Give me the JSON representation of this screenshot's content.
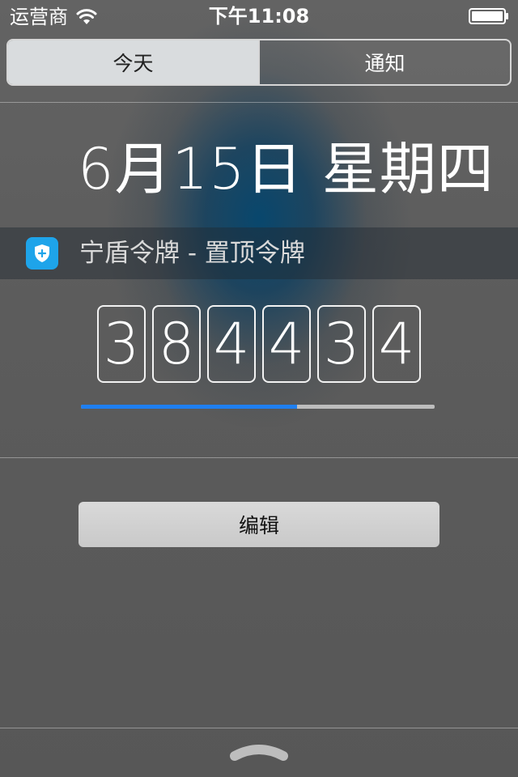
{
  "status_bar": {
    "carrier": "运营商",
    "time": "下午11:08"
  },
  "segmented": {
    "today_label": "今天",
    "notifications_label": "通知"
  },
  "date": {
    "text": "6月15日 星期四"
  },
  "widget": {
    "title": "宁盾令牌 - 置顶令牌",
    "token_digits": [
      "3",
      "8",
      "4",
      "4",
      "3",
      "4"
    ],
    "progress_fraction": 0.61
  },
  "edit_button": {
    "label": "编辑"
  },
  "colors": {
    "accent_blue": "#1f7ff0",
    "app_icon_blue": "#1ea4ea",
    "segment_active_bg": "#d9dcde"
  },
  "icons": {
    "wifi": "wifi-icon",
    "battery": "battery-icon",
    "app": "shield-icon",
    "grabber": "chevron-up-icon"
  }
}
